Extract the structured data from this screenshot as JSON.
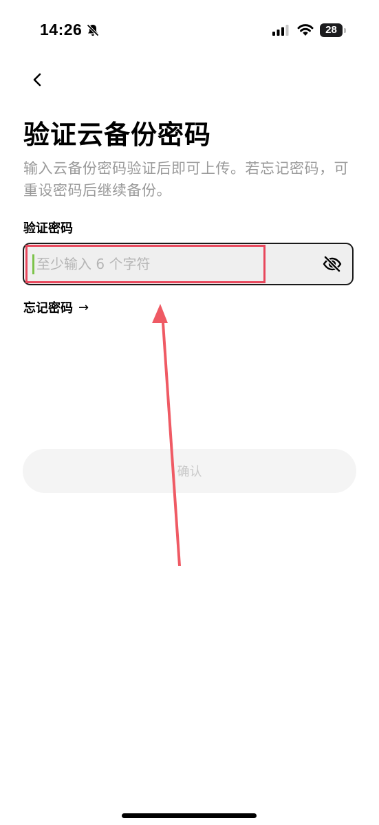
{
  "status_bar": {
    "time": "14:26",
    "battery_level": "28"
  },
  "header": {
    "title": "验证云备份密码",
    "description": "输入云备份密码验证后即可上传。若忘记密码，可重设密码后继续备份。"
  },
  "form": {
    "field_label": "验证密码",
    "password_placeholder": "至少输入 6 个字符",
    "password_value": "",
    "forgot_password_label": "忘记密码",
    "forgot_password_arrow": "→",
    "confirm_label": "确认"
  },
  "colors": {
    "annotation": "#e8475c",
    "cursor": "#7cc34a",
    "description_text": "#9a9a9a",
    "disabled_button_bg": "#f4f4f4",
    "disabled_button_text": "#c9c9c9"
  },
  "icons": {
    "back": "chevron-left-icon",
    "visibility": "eye-off-icon",
    "bell": "bell-slash-icon",
    "signal": "cellular-signal-icon",
    "wifi": "wifi-icon",
    "battery": "battery-icon"
  }
}
